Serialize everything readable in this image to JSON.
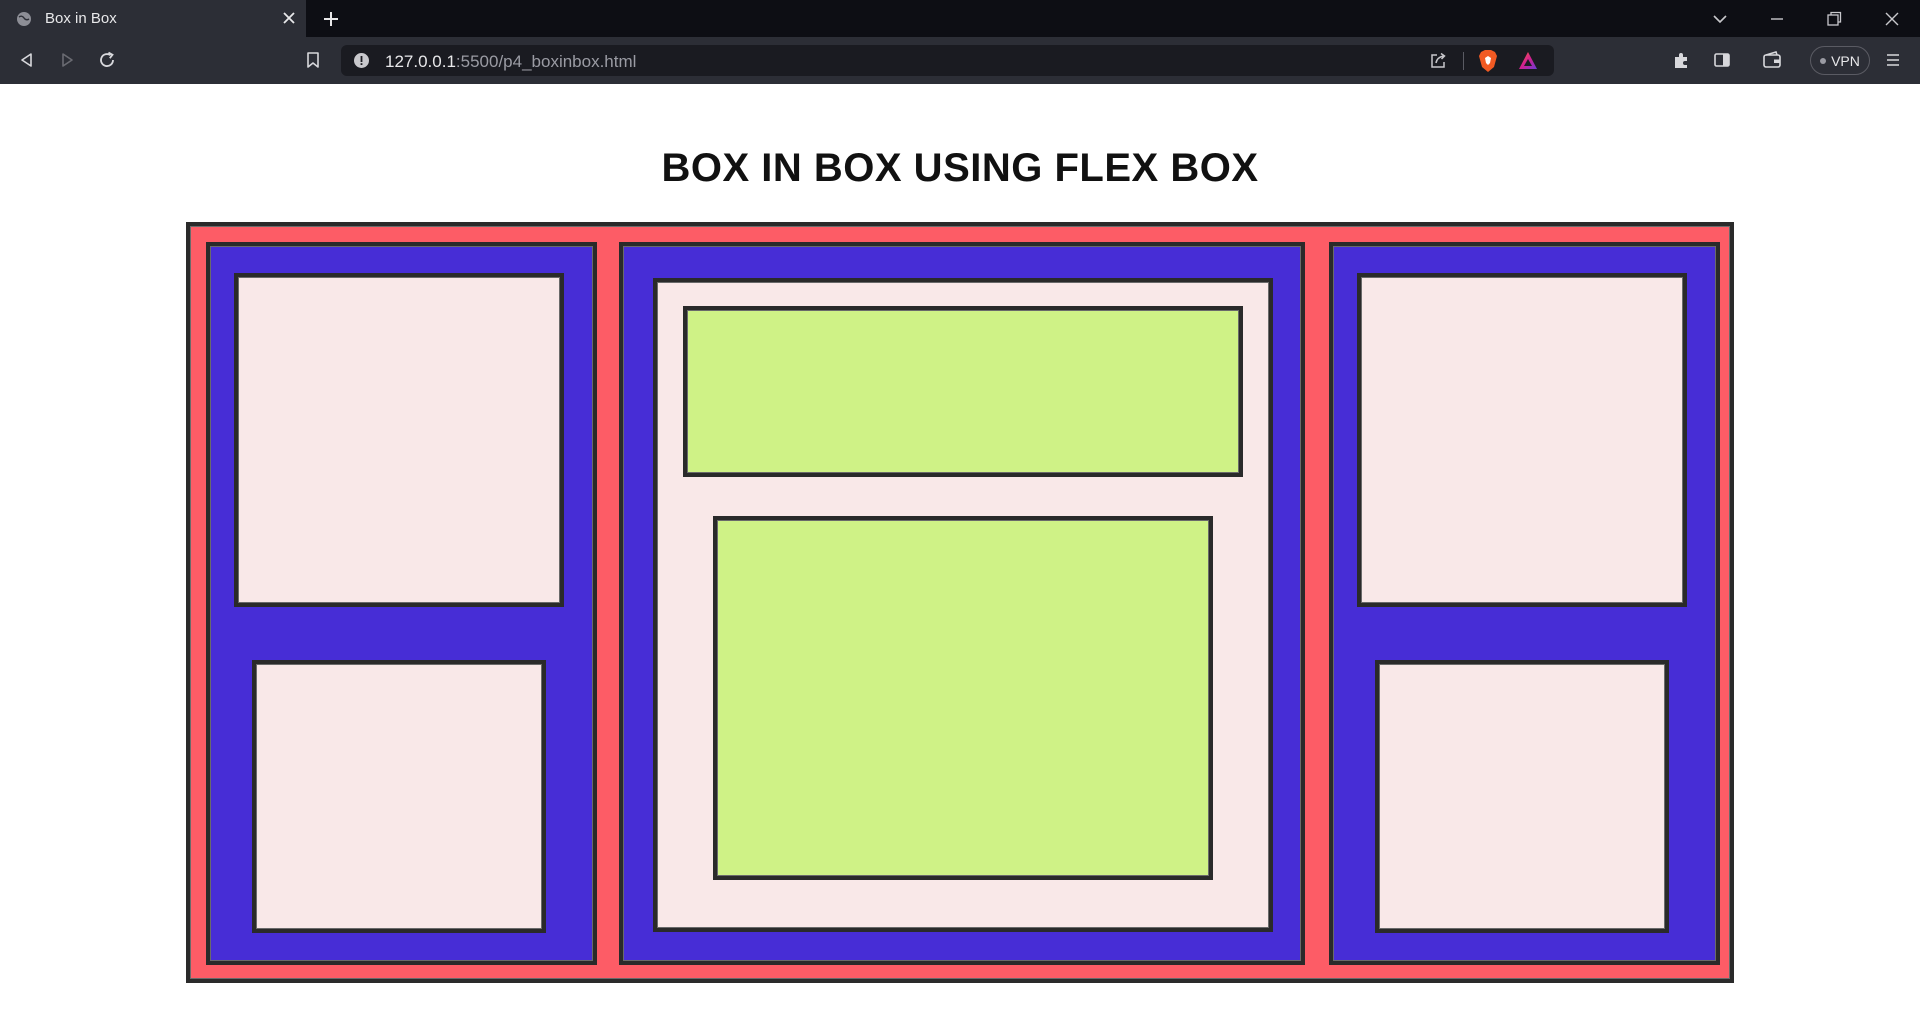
{
  "browser": {
    "tab_title": "Box in Box",
    "url_host": "127.0.0.1",
    "url_rest": ":5500/p4_boxinbox.html",
    "vpn_label": "VPN"
  },
  "page": {
    "heading": "BOX IN BOX USING FLEX BOX"
  },
  "colors": {
    "outer": "#fd5c66",
    "column": "#472dd6",
    "inner_box": "#f9e8e8",
    "green_box": "#cff286",
    "border": "#2a2a2a"
  }
}
